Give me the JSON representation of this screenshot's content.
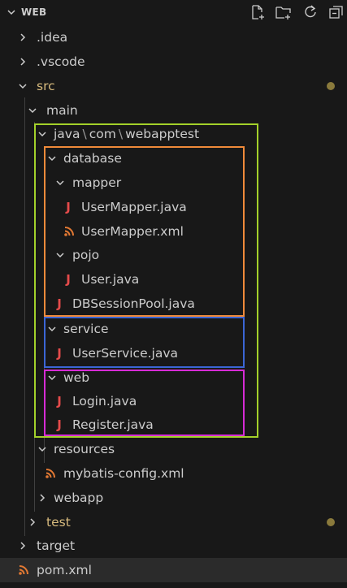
{
  "explorer": {
    "title": "WEB",
    "actions": [
      "new-file-icon",
      "new-folder-icon",
      "refresh-icon",
      "collapse-all-icon"
    ]
  },
  "tree": {
    "idea": ".idea",
    "vscode": ".vscode",
    "src": "src",
    "main": "main",
    "java_path": [
      "java",
      "com",
      "webapptest"
    ],
    "path_separator": "\\",
    "database": "database",
    "mapper": "mapper",
    "usermapper_java": "UserMapper.java",
    "usermapper_xml": "UserMapper.xml",
    "pojo": "pojo",
    "user_java": "User.java",
    "dbsessionpool": "DBSessionPool.java",
    "service": "service",
    "userservice": "UserService.java",
    "web": "web",
    "login": "Login.java",
    "register": "Register.java",
    "resources": "resources",
    "mybatis_config": "mybatis-config.xml",
    "webapp": "webapp",
    "test": "test",
    "target": "target",
    "pom": "pom.xml"
  },
  "java_glyph": "J",
  "colors": {
    "modified": "#d7ba7d",
    "java_icon": "#e54b4b",
    "xml_icon": "#e37933",
    "box_package": "#a3d12a",
    "box_database": "#ef8a3a",
    "box_service": "#3b66d6",
    "box_web": "#d72bd6"
  }
}
